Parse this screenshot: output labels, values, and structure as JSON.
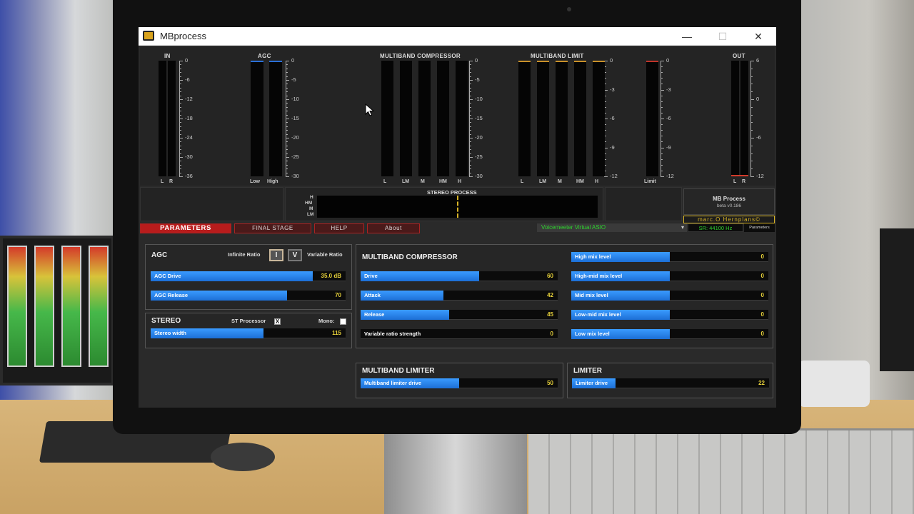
{
  "window": {
    "title": "MBprocess",
    "minimize": "—",
    "maximize": "☐",
    "close": "✕"
  },
  "meters": {
    "in": {
      "label": "IN",
      "scale": [
        "0",
        "-6",
        "-12",
        "-18",
        "-24",
        "-30",
        "-36"
      ],
      "channels": [
        "L",
        "R"
      ]
    },
    "agc": {
      "label": "AGC",
      "scale": [
        "0",
        "-5",
        "-10",
        "-15",
        "-20",
        "-25",
        "-30"
      ],
      "channels": [
        "Low",
        "High"
      ]
    },
    "mb_compressor": {
      "label": "MULTIBAND COMPRESSOR",
      "scale": [
        "0",
        "-5",
        "-10",
        "-15",
        "-20",
        "-25",
        "-30"
      ],
      "bands": [
        "L",
        "LM",
        "M",
        "HM",
        "H"
      ]
    },
    "mb_limit": {
      "label": "MULTIBAND LIMIT",
      "scale": [
        "0",
        "-3",
        "-6",
        "-9",
        "-12"
      ],
      "bands": [
        "L",
        "LM",
        "M",
        "HM",
        "H"
      ]
    },
    "limit": {
      "scale": [
        "0",
        "-3",
        "-6",
        "-9",
        "-12"
      ],
      "channel": "Limit"
    },
    "out": {
      "label": "OUT",
      "scale": [
        "6",
        "0",
        "-6",
        "-12"
      ],
      "channels": [
        "L",
        "R"
      ]
    }
  },
  "stereo_process": {
    "label": "STEREO PROCESS",
    "bands": [
      "H",
      "HM",
      "M",
      "LM"
    ]
  },
  "info": {
    "name": "MB Process",
    "version": "beta v0.186",
    "author": "marc.O Hernplans©"
  },
  "tabs": [
    "PARAMETERS",
    "FINAL STAGE",
    "HELP",
    "About"
  ],
  "audio": {
    "device": "Voicemeeter Virtual ASIO",
    "sample_rate": "SR: 44100 Hz",
    "params_label": "Parameters"
  },
  "agc_panel": {
    "title": "AGC",
    "infinite_ratio": "Infinite Ratio",
    "variable_ratio": "Variable Ratio",
    "btn_i": "I",
    "btn_v": "V",
    "drive": {
      "label": "AGC Drive",
      "value": "35.0 dB",
      "fraction": 0.83
    },
    "release": {
      "label": "AGC Release",
      "value": "70",
      "fraction": 0.7
    }
  },
  "stereo_panel": {
    "title": "STEREO",
    "st_processor": "ST Processor",
    "st_checked": "X",
    "mono": "Mono:",
    "width": {
      "label": "Stereo width",
      "value": "115",
      "fraction": 0.58
    }
  },
  "mbc_panel": {
    "title": "MULTIBAND COMPRESSOR",
    "sliders": [
      {
        "label": "Drive",
        "value": "60",
        "fraction": 0.6
      },
      {
        "label": "Attack",
        "value": "42",
        "fraction": 0.42
      },
      {
        "label": "Release",
        "value": "45",
        "fraction": 0.45
      },
      {
        "label": "Variable ratio strength",
        "value": "0",
        "fraction": 0.0
      }
    ],
    "mix": [
      {
        "label": "High mix level",
        "value": "0",
        "fraction": 0.5
      },
      {
        "label": "High-mid mix level",
        "value": "0",
        "fraction": 0.5
      },
      {
        "label": "Mid mix level",
        "value": "0",
        "fraction": 0.5
      },
      {
        "label": "Low-mid mix level",
        "value": "0",
        "fraction": 0.5
      },
      {
        "label": "Low mix level",
        "value": "0",
        "fraction": 0.5
      }
    ]
  },
  "mbl_panel": {
    "title": "MULTIBAND LIMITER",
    "drive": {
      "label": "Multiband limiter drive",
      "value": "50",
      "fraction": 0.5
    }
  },
  "lim_panel": {
    "title": "LIMITER",
    "drive": {
      "label": "Limiter drive",
      "value": "22",
      "fraction": 0.22
    }
  },
  "colors": {
    "accent": "#1c6fd6",
    "value": "#e8d23a",
    "tab": "#b81c1c",
    "green_text": "#2ed22e"
  }
}
